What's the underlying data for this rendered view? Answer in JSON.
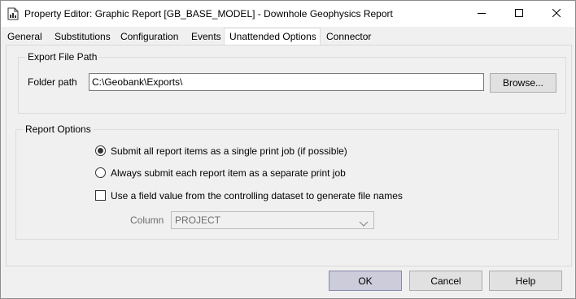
{
  "window": {
    "title": "Property Editor: Graphic Report [GB_BASE_MODEL] - Downhole Geophysics Report",
    "minimize_icon": "minimize-icon",
    "maximize_icon": "maximize-icon",
    "close_icon": "close-icon"
  },
  "tabs": [
    {
      "label": "General"
    },
    {
      "label": "Substitutions"
    },
    {
      "label": "Configuration"
    },
    {
      "label": "Events"
    },
    {
      "label": "Unattended Options",
      "active": true
    },
    {
      "label": "Connector"
    }
  ],
  "export_group": {
    "legend": "Export File Path",
    "folder_label": "Folder path",
    "folder_value": "C:\\Geobank\\Exports\\",
    "browse_label": "Browse..."
  },
  "report_group": {
    "legend": "Report Options",
    "radio_single": {
      "label": "Submit all report items as a single print job (if possible)",
      "checked": true
    },
    "radio_separate": {
      "label": "Always submit each report item as a separate print job",
      "checked": false
    },
    "checkbox_field": {
      "label": "Use a field value from the controlling dataset to generate file names",
      "checked": false
    },
    "column_label": "Column",
    "column_value": "PROJECT"
  },
  "footer": {
    "ok_label": "OK",
    "cancel_label": "Cancel",
    "help_label": "Help"
  }
}
